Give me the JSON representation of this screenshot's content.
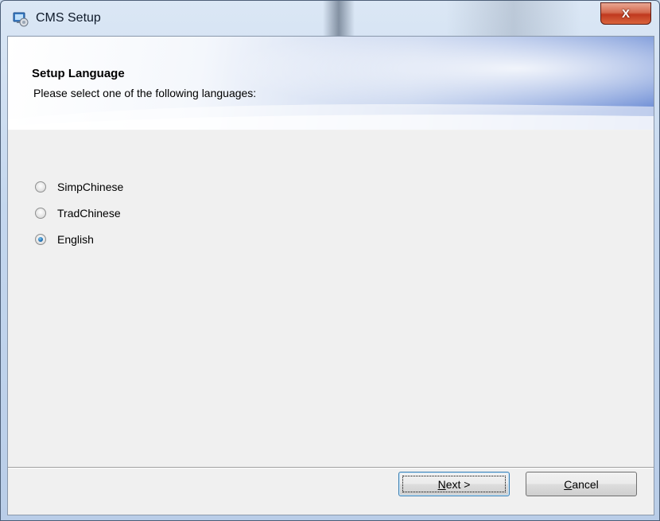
{
  "window": {
    "title": "CMS Setup",
    "close_glyph": "X",
    "icon": "installer-icon"
  },
  "banner": {
    "title": "Setup Language",
    "subtitle": "Please select one of the following languages:"
  },
  "languages": {
    "selected": "English",
    "options": [
      {
        "label": "SimpChinese",
        "checked": false
      },
      {
        "label": "TradChinese",
        "checked": false
      },
      {
        "label": "English",
        "checked": true
      }
    ]
  },
  "buttons": {
    "next": {
      "mnemonic": "N",
      "rest": "ext >"
    },
    "cancel": {
      "mnemonic": "C",
      "rest": "ancel"
    }
  },
  "colors": {
    "close_button": "#c0391f",
    "radio_selected": "#1e6fb3",
    "default_button_border": "#3c7fb1"
  }
}
